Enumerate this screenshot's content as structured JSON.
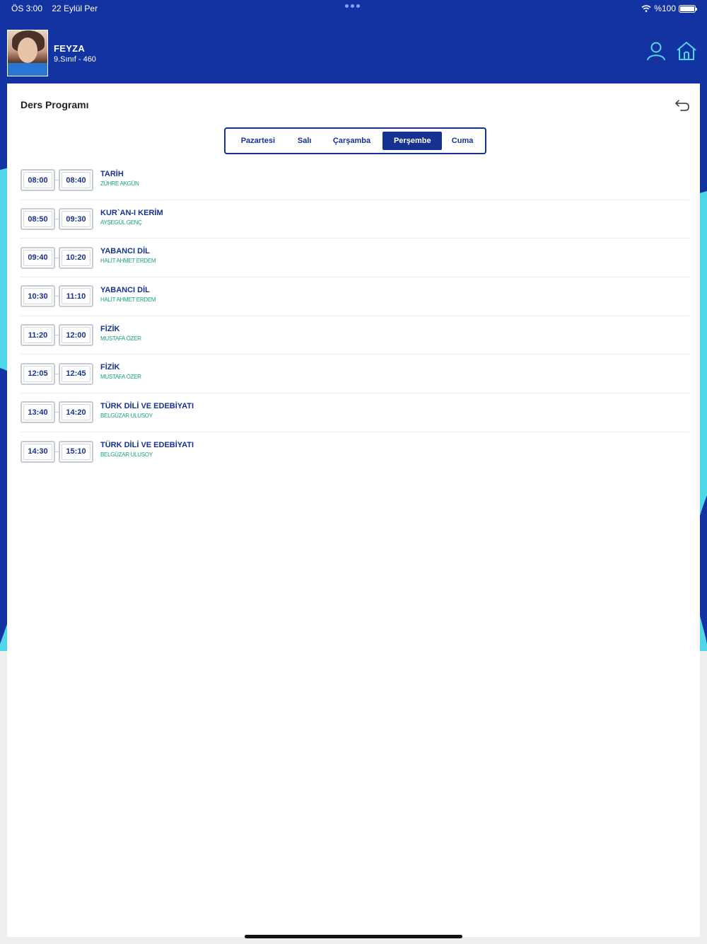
{
  "status_bar": {
    "time": "ÖS 3:00",
    "date": "22 Eylül Per",
    "battery": "%100"
  },
  "user": {
    "name": "FEYZA",
    "class": "9.Sınıf - 460"
  },
  "icons": {
    "profile": "user-icon",
    "home": "home-icon",
    "back": "back-arrow-icon"
  },
  "colors": {
    "primary": "#16318f",
    "header_bg": "#1333a3",
    "teacher_text": "#14a37c",
    "accent_wave": "#4fd6e8"
  },
  "page": {
    "title": "Ders Programı"
  },
  "days": [
    {
      "label": "Pazartesi",
      "active": false
    },
    {
      "label": "Salı",
      "active": false
    },
    {
      "label": "Çarşamba",
      "active": false
    },
    {
      "label": "Perşembe",
      "active": true
    },
    {
      "label": "Cuma",
      "active": false
    }
  ],
  "schedule": [
    {
      "start": "08:00",
      "end": "08:40",
      "lesson": "TARİH",
      "teacher": "ZÜHRE AKGÜN"
    },
    {
      "start": "08:50",
      "end": "09:30",
      "lesson": "KUR`AN-I KERİM",
      "teacher": "AYŞEGÜL GENÇ"
    },
    {
      "start": "09:40",
      "end": "10:20",
      "lesson": "YABANCI DİL",
      "teacher": "HALİT AHMET ERDEM"
    },
    {
      "start": "10:30",
      "end": "11:10",
      "lesson": "YABANCI DİL",
      "teacher": "HALİT AHMET ERDEM"
    },
    {
      "start": "11:20",
      "end": "12:00",
      "lesson": "FİZİK",
      "teacher": "MUSTAFA ÖZER"
    },
    {
      "start": "12:05",
      "end": "12:45",
      "lesson": "FİZİK",
      "teacher": "MUSTAFA ÖZER"
    },
    {
      "start": "13:40",
      "end": "14:20",
      "lesson": "TÜRK DİLİ VE EDEBİYATI",
      "teacher": "BELGÜZAR ULUSOY"
    },
    {
      "start": "14:30",
      "end": "15:10",
      "lesson": "TÜRK DİLİ VE EDEBİYATI",
      "teacher": "BELGÜZAR ULUSOY"
    }
  ]
}
